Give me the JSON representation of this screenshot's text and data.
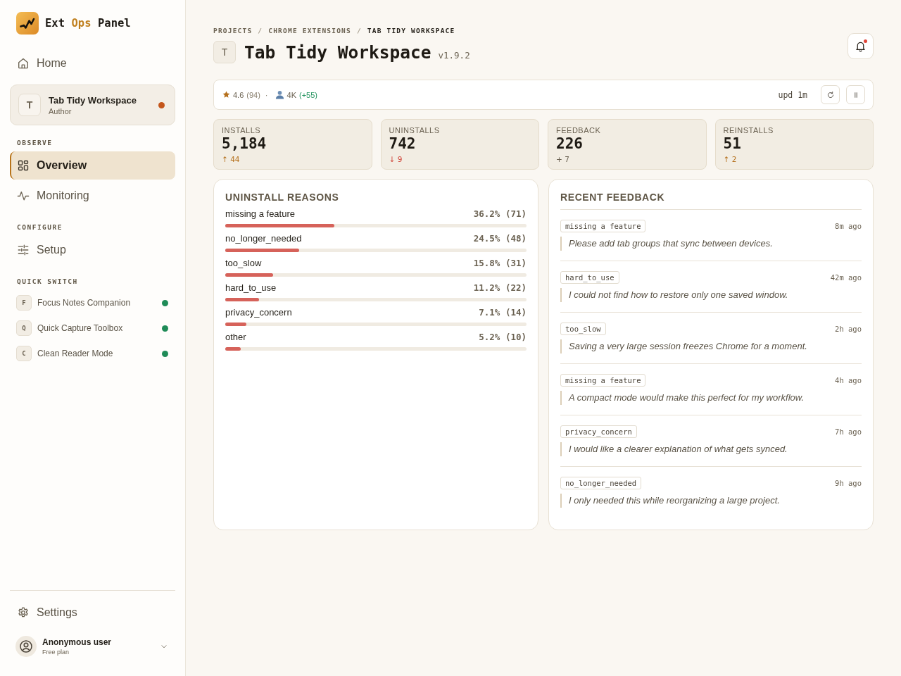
{
  "sidebar": {
    "brand": {
      "parts": [
        {
          "text": "Ext",
          "accent": false
        },
        {
          "text": "Ops",
          "accent": true
        },
        {
          "text": "Panel",
          "accent": false
        }
      ]
    },
    "home": {
      "label": "Home",
      "selected": false
    },
    "project": {
      "initial": "T",
      "name": "Tab Tidy Workspace",
      "role": "Author",
      "color": "#c4561c"
    },
    "sections": [
      {
        "title": "OBSERVE",
        "items": [
          {
            "label": "Overview",
            "selected": true
          },
          {
            "label": "Monitoring",
            "selected": false
          }
        ]
      },
      {
        "title": "CONFIGURE",
        "items": [
          {
            "label": "Setup",
            "selected": false
          }
        ]
      }
    ],
    "quick_switch": {
      "title": "QUICK SWITCH",
      "items": [
        {
          "initial": "F",
          "label": "Focus Notes Companion",
          "color": "#1f8b57"
        },
        {
          "initial": "Q",
          "label": "Quick Capture Toolbox",
          "color": "#1f8b57"
        },
        {
          "initial": "C",
          "label": "Clean Reader Mode",
          "color": "#1f8b57"
        }
      ]
    },
    "settings": {
      "label": "Settings",
      "selected": false
    },
    "user": {
      "name": "Anonymous user",
      "plan": "Free plan"
    }
  },
  "header": {
    "breadcrumb": [
      {
        "label": "PROJECTS",
        "current": false,
        "separator": "/"
      },
      {
        "label": "CHROME EXTENSIONS",
        "current": false,
        "separator": "/"
      },
      {
        "label": "TAB TIDY WORKSPACE",
        "current": true
      }
    ],
    "initial": "T",
    "title": "Tab Tidy Workspace",
    "version": "v1.9.2",
    "notifications": {
      "unread": true
    }
  },
  "summary_bar": {
    "rating": "4.6",
    "rating_count": "(94)",
    "separator": "·",
    "users": "4K",
    "users_change": "(+55)",
    "updated": "upd 1m"
  },
  "stats": [
    {
      "label": "INSTALLS",
      "value": "5,184",
      "delta": "↑ 44",
      "color": "#b5701c"
    },
    {
      "label": "UNINSTALLS",
      "value": "742",
      "delta": "↓ 9",
      "color": "#d0453a"
    },
    {
      "label": "FEEDBACK",
      "value": "226",
      "delta": "+ 7",
      "color": "#6b6252"
    },
    {
      "label": "REINSTALLS",
      "value": "51",
      "delta": "↑ 2",
      "color": "#b5701c"
    }
  ],
  "uninstall_reasons": {
    "title": "UNINSTALL REASONS",
    "items": [
      {
        "label": "missing a feature",
        "reading": "36.2% (71)",
        "level": 0.362
      },
      {
        "label": "no_longer_needed",
        "reading": "24.5% (48)",
        "level": 0.245
      },
      {
        "label": "too_slow",
        "reading": "15.8% (31)",
        "level": 0.158
      },
      {
        "label": "hard_to_use",
        "reading": "11.2% (22)",
        "level": 0.112
      },
      {
        "label": "privacy_concern",
        "reading": "7.1% (14)",
        "level": 0.071
      },
      {
        "label": "other",
        "reading": "5.2% (10)",
        "level": 0.052
      }
    ]
  },
  "recent_feedback": {
    "title": "RECENT FEEDBACK",
    "items": [
      {
        "tag": "missing a feature",
        "time": "8m ago",
        "text": "Please add tab groups that sync between devices."
      },
      {
        "tag": "hard_to_use",
        "time": "42m ago",
        "text": "I could not find how to restore only one saved window."
      },
      {
        "tag": "too_slow",
        "time": "2h ago",
        "text": "Saving a very large session freezes Chrome for a moment."
      },
      {
        "tag": "missing a feature",
        "time": "4h ago",
        "text": "A compact mode would make this perfect for my workflow."
      },
      {
        "tag": "privacy_concern",
        "time": "7h ago",
        "text": "I would like a clearer explanation of what gets synced."
      },
      {
        "tag": "no_longer_needed",
        "time": "9h ago",
        "text": "I only needed this while reorganizing a large project."
      }
    ]
  }
}
